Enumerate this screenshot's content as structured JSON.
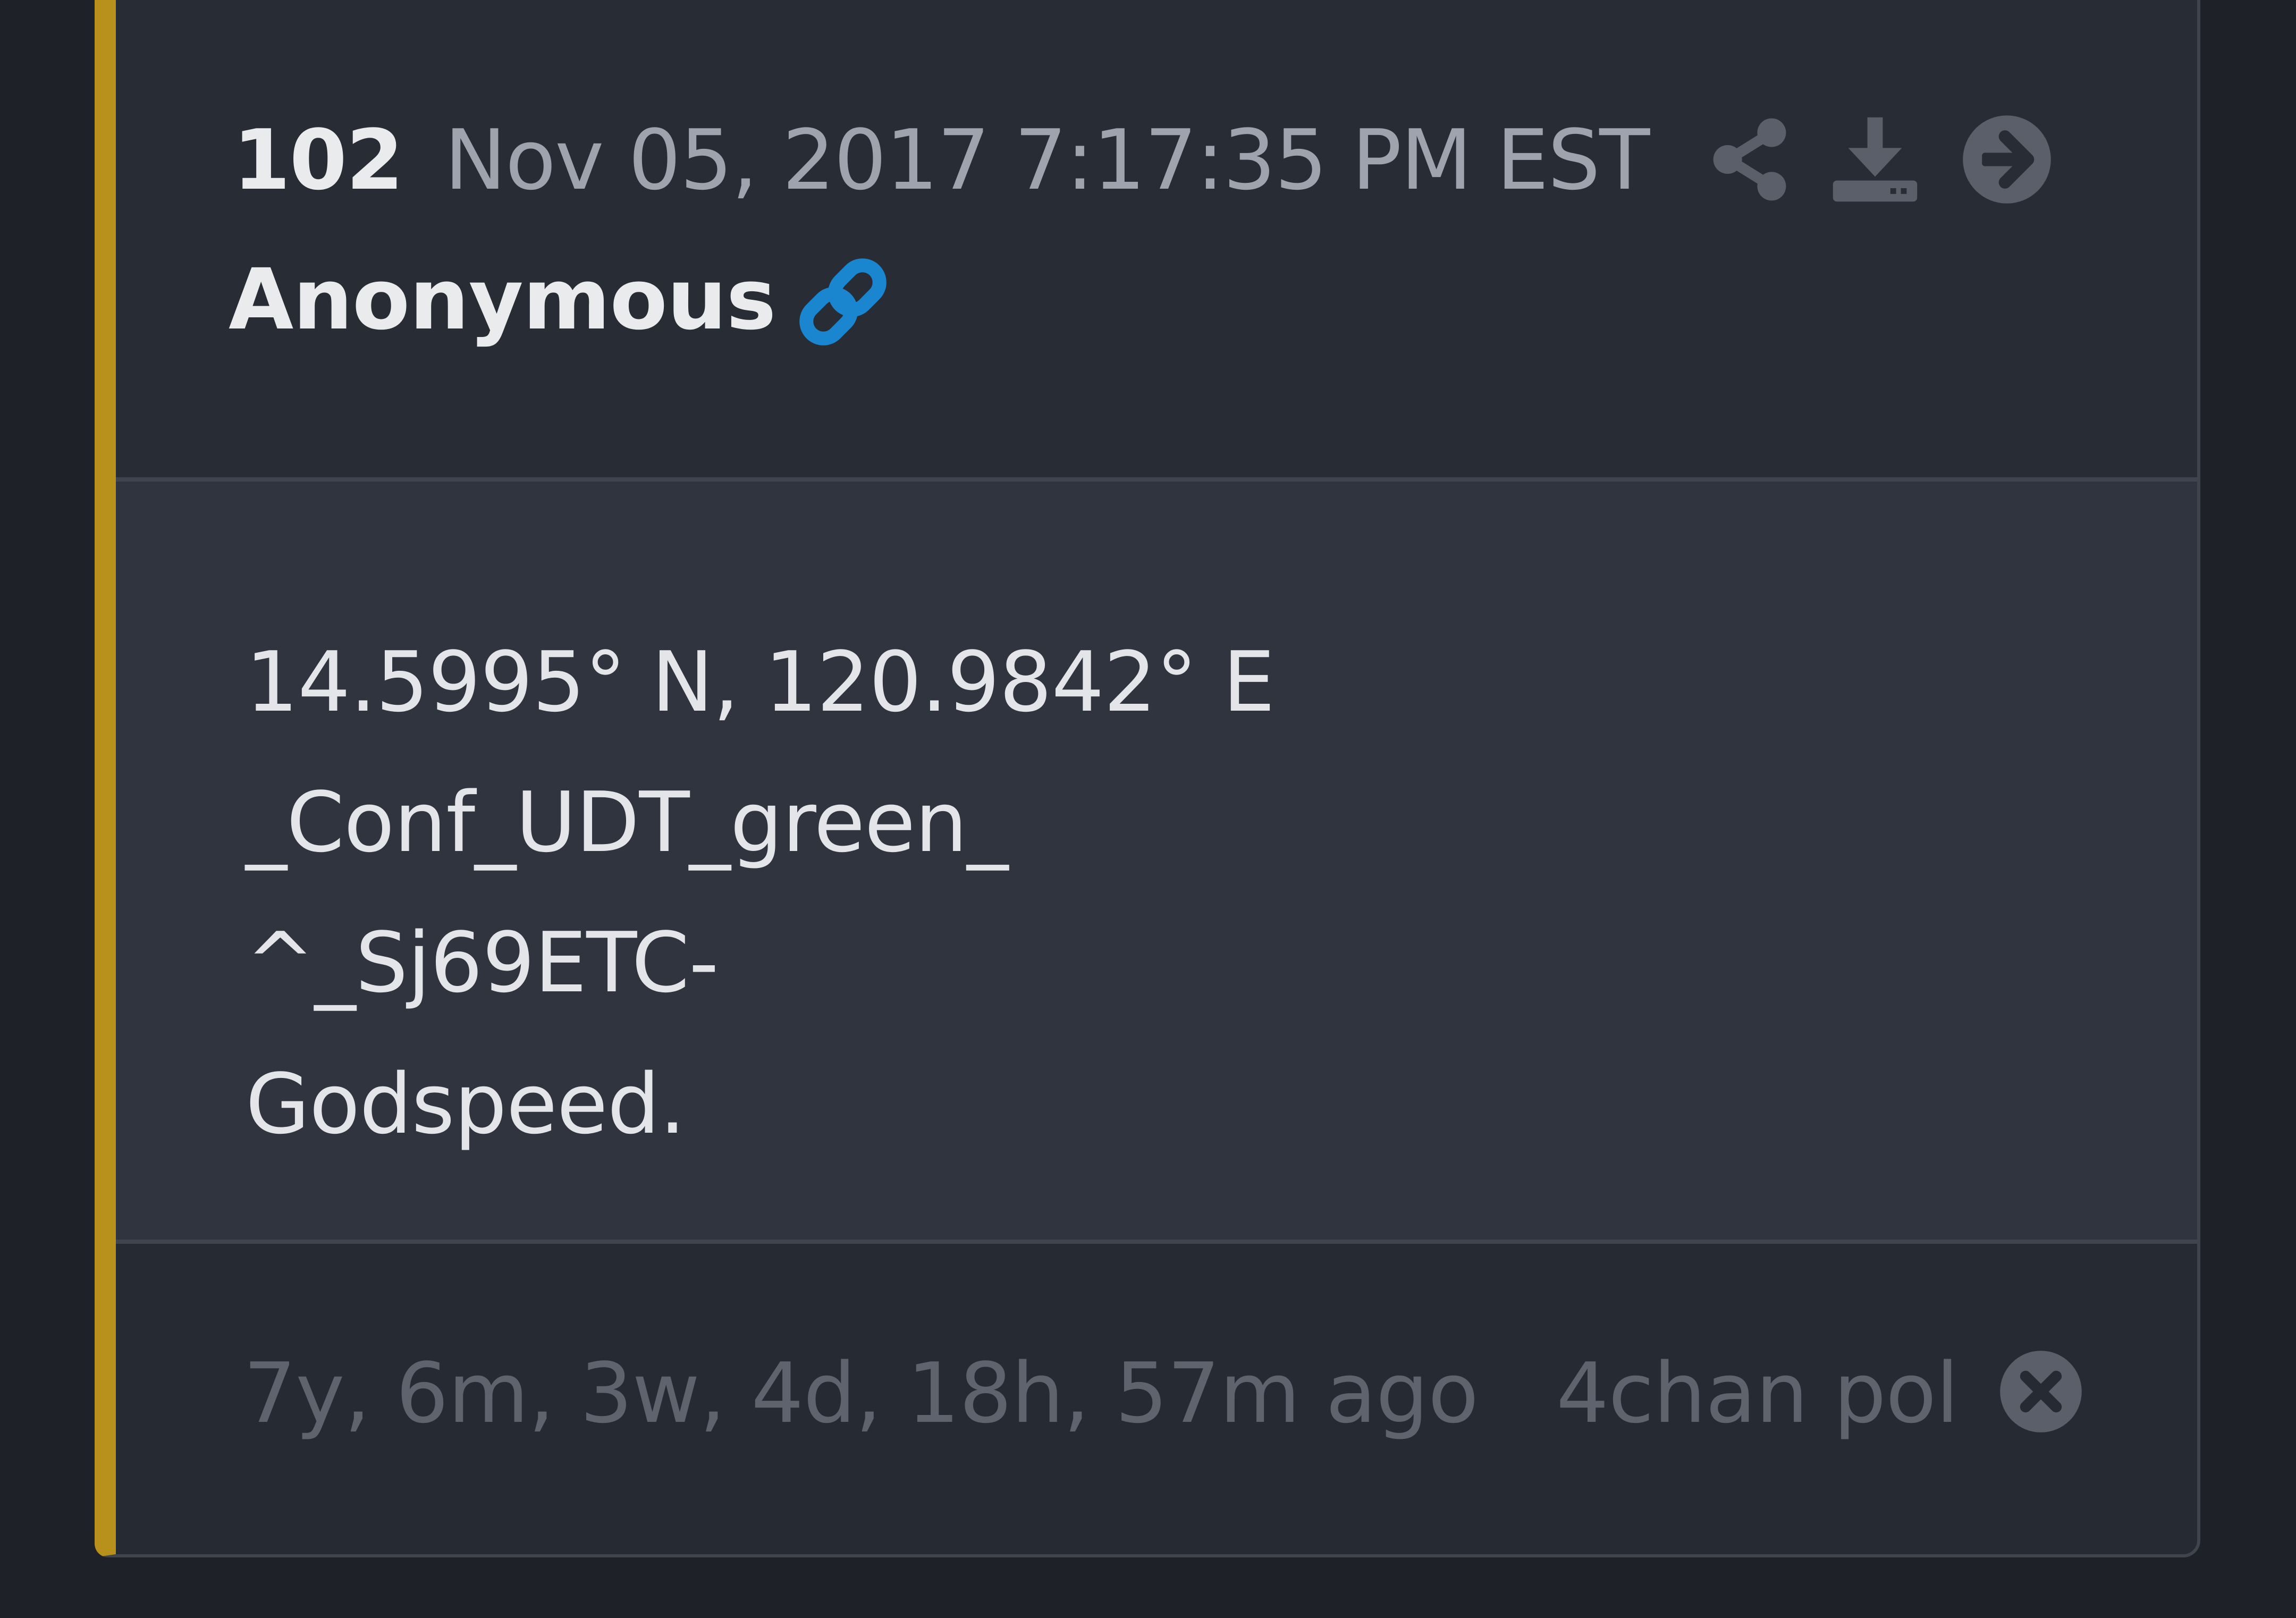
{
  "post": {
    "number": "102",
    "timestamp": "Nov 05, 2017 7:17:35 PM EST",
    "author": "Anonymous",
    "body_lines": [
      "14.5995° N, 120.9842° E",
      "_Conf_UDT_green_",
      "^_Sj69ETC-",
      "Godspeed."
    ],
    "elapsed": "7y, 6m, 3w, 4d, 18h, 57m ago",
    "source": "4chan pol"
  },
  "icons": {
    "author_link": "link-icon",
    "share": "share-icon",
    "download": "download-icon",
    "goto": "arrow-right-circle-icon",
    "close": "close-circle-icon"
  },
  "colors": {
    "accent_bar": "#b8901c",
    "link_icon": "#1a86d0",
    "page_background": "#1e2127",
    "card_background": "#282c34",
    "body_background": "#2f343f"
  }
}
